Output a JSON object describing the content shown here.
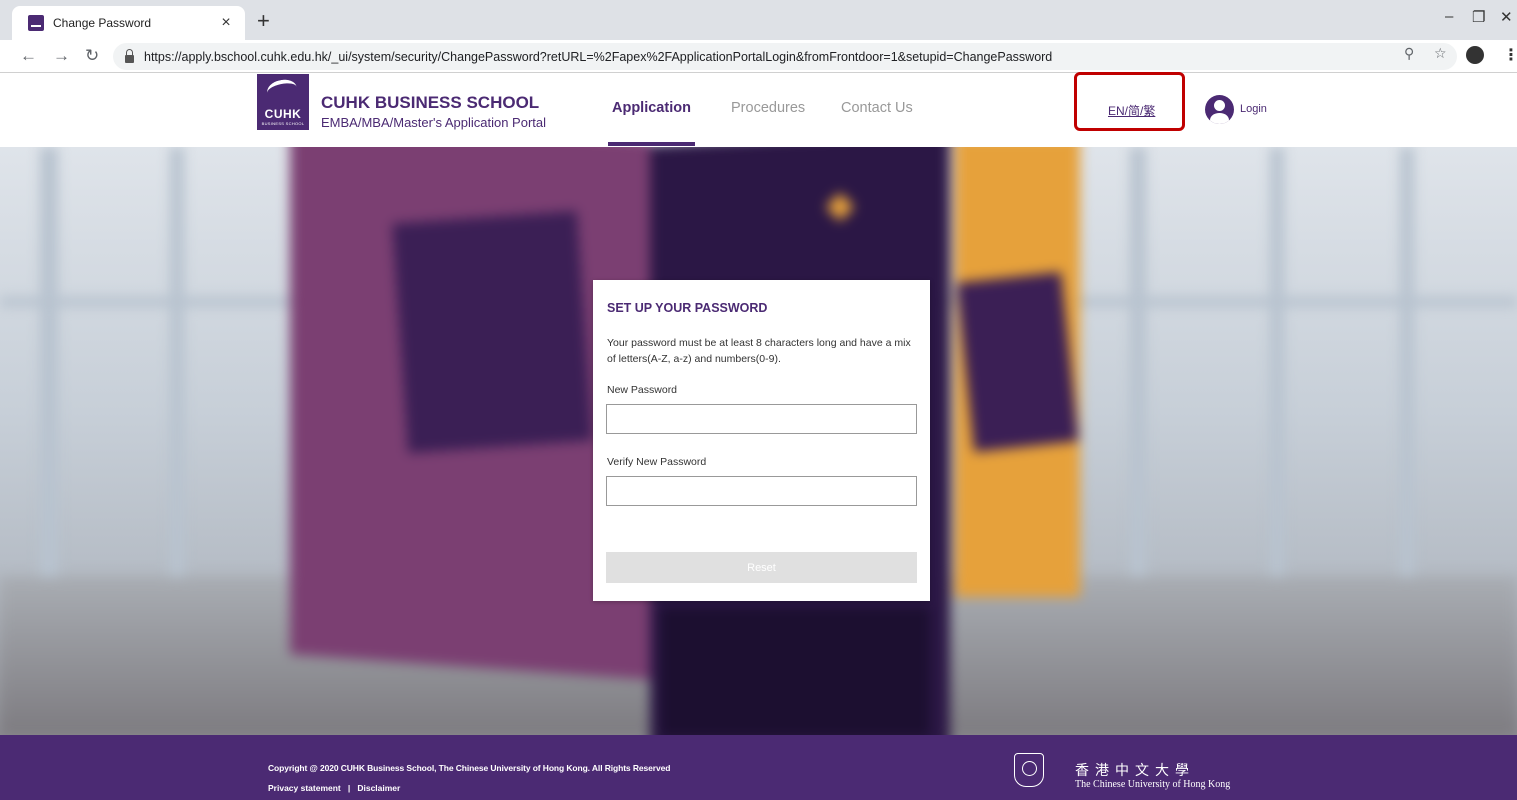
{
  "browser": {
    "tab_title": "Change Password",
    "tab_close": "×",
    "new_tab": "+",
    "url": "https://apply.bschool.cuhk.edu.hk/_ui/system/security/ChangePassword?retURL=%2Fapex%2FApplicationPortalLogin&fromFrontdoor=1&setupid=ChangePassword",
    "icons": [
      "back-icon",
      "forward-icon",
      "reload-icon",
      "lock-icon",
      "zoom-icon",
      "star-icon",
      "profile-icon",
      "menu-icon"
    ]
  },
  "header": {
    "logo_text": "CUHK",
    "logo_sub": "BUSINESS SCHOOL",
    "brand_title": "CUHK BUSINESS SCHOOL",
    "brand_sub": "EMBA/MBA/Master's Application Portal",
    "nav": [
      {
        "label": "Application",
        "active": true
      },
      {
        "label": "Procedures",
        "active": false
      },
      {
        "label": "Contact Us",
        "active": false
      }
    ],
    "language": "EN/简/繁",
    "login": "Login"
  },
  "form": {
    "title": "SET UP YOUR PASSWORD",
    "description": "Your password must be at least 8 characters long and have a mix of letters(A-Z, a-z) and numbers(0-9).",
    "new_password_label": "New Password",
    "new_password_value": "",
    "verify_password_label": "Verify New Password",
    "verify_password_value": "",
    "reset_label": "Reset"
  },
  "footer": {
    "copyright": "Copyright @ 2020 CUHK Business School, The Chinese University of Hong Kong. All Rights Reserved",
    "privacy": "Privacy statement",
    "separator": "|",
    "disclaimer": "Disclaimer",
    "university_cn": "香港中文大學",
    "university_en": "The Chinese University of Hong Kong"
  },
  "colors": {
    "brand_purple": "#4b2a73",
    "highlight_red": "#c00000",
    "button_disabled": "#e0e0e0"
  }
}
